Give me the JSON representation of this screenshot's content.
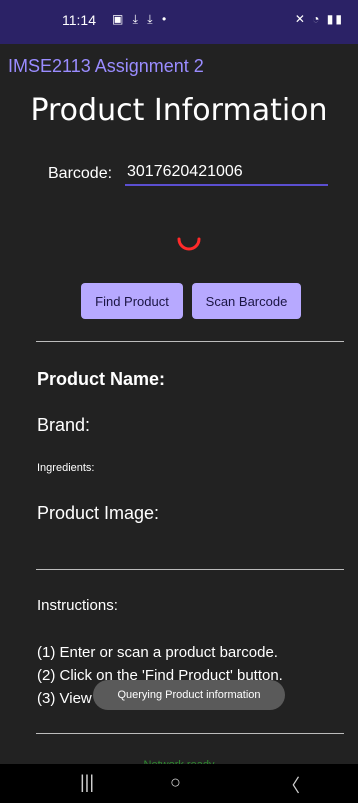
{
  "status_bar": {
    "time": "11:14",
    "left_icons": "▣ ⤓ ⤓ •",
    "right_icons": "✕ ◔ ▮▮"
  },
  "app": {
    "title": "IMSE2113 Assignment 2"
  },
  "main": {
    "page_title": "Product Information",
    "barcode_label": "Barcode:",
    "barcode_value": "3017620421006",
    "find_button": "Find Product",
    "scan_button": "Scan Barcode"
  },
  "product": {
    "name_label": "Product Name:",
    "brand_label": "Brand:",
    "ingredients_label": "Ingredients:",
    "image_label": "Product Image:"
  },
  "instructions": {
    "heading": "Instructions:",
    "steps": [
      "(1) Enter or scan a product barcode.",
      "(2) Click on the 'Find Product' button.",
      "(3) View the product information"
    ]
  },
  "toast": "Querying Product information",
  "network_status": "Network ready",
  "nav_bar": {
    "recents": "|||",
    "home": "○",
    "back": "〈"
  },
  "colors": {
    "status_bar": "#2b2266",
    "accent": "#9a8cff",
    "button": "#b7a9ff",
    "spinner": "#ff2a2a",
    "network_ok": "#2f8a2f"
  }
}
